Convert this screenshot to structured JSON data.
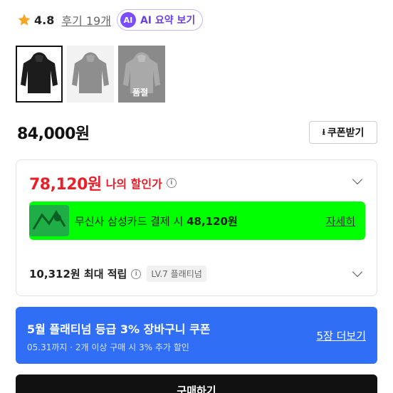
{
  "rating": {
    "value": "4.8",
    "review_link": "후기 19개",
    "ai_badge": "AI",
    "ai_label": "AI 요약 보기"
  },
  "thumbnails": [
    {
      "color": "black",
      "selected": true
    },
    {
      "color": "gray",
      "selected": false
    },
    {
      "color": "gray",
      "selected": false,
      "soldout_label": "품절"
    }
  ],
  "price": {
    "original": "84,000원",
    "coupon_button": "쿠폰받기"
  },
  "discount": {
    "price": "78,120원",
    "label": "나의 할인가"
  },
  "card_promo": {
    "text_prefix": "무신사 삼성카드 결제 시 ",
    "amount": "48,120원",
    "detail_link": "자세히"
  },
  "points": {
    "text": "10,312원 최대 적립",
    "level": "LV.7 플래티넘"
  },
  "platinum": {
    "title": "5월 플래티넘 등급 3% 장바구니 쿠폰",
    "subtitle": "05.31까지 · 2개 이상 구매 시 3% 추가 할인",
    "more_link": "5장 더보기"
  },
  "buy": {
    "label": "구매하기"
  },
  "colors": {
    "discount_red": "#e8202a",
    "platinum_blue": "#2f6ef5",
    "promo_green": "#00ff00",
    "ai_purple": "#7b4dff"
  }
}
